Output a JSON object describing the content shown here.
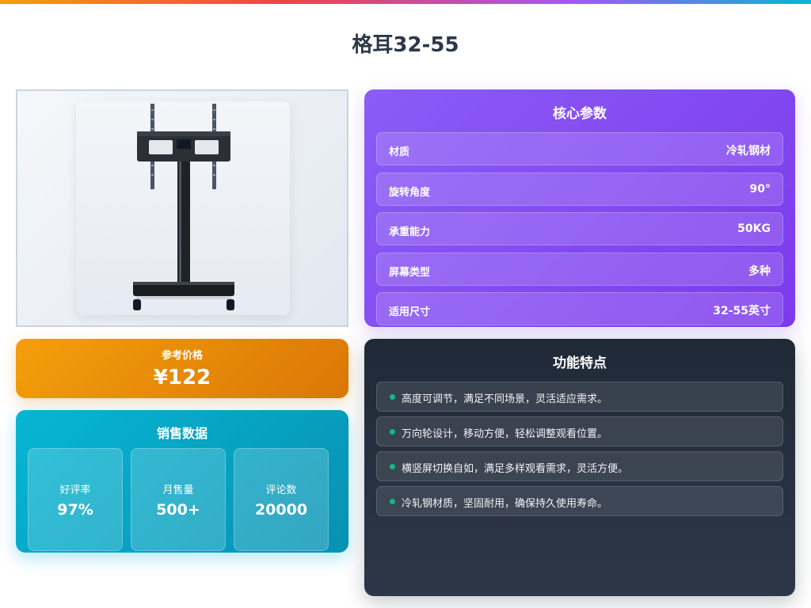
{
  "title": "格耳32-55",
  "product_image": {
    "name": "tv-floor-stand-image"
  },
  "price": {
    "label": "参考价格",
    "value": "¥122"
  },
  "sales": {
    "title": "销售数据",
    "stats": [
      {
        "label": "好评率",
        "value": "97%"
      },
      {
        "label": "月售量",
        "value": "500+"
      },
      {
        "label": "评论数",
        "value": "20000"
      }
    ]
  },
  "params": {
    "title": "核心参数",
    "rows": [
      {
        "key": "材质",
        "value": "冷轧钢材"
      },
      {
        "key": "旋转角度",
        "value": "90°"
      },
      {
        "key": "承重能力",
        "value": "50KG"
      },
      {
        "key": "屏幕类型",
        "value": "多种"
      },
      {
        "key": "适用尺寸",
        "value": "32-55英寸"
      }
    ]
  },
  "features": {
    "title": "功能特点",
    "items": [
      "高度可调节，满足不同场景，灵活适应需求。",
      "万向轮设计，移动方便，轻松调整观看位置。",
      "横竖屏切换自如，满足多样观看需求，灵活方便。",
      "冷轧钢材质，坚固耐用，确保持久使用寿命。"
    ]
  },
  "colors": {
    "price_gradient": [
      "#f59e0b",
      "#d97706"
    ],
    "sales_gradient": [
      "#06b6d4",
      "#0891b2"
    ],
    "params_gradient": [
      "#8b5cf6",
      "#7c3aed"
    ],
    "features_gradient": [
      "#1f2937",
      "#2d3748"
    ],
    "bullet": "#10b981"
  }
}
